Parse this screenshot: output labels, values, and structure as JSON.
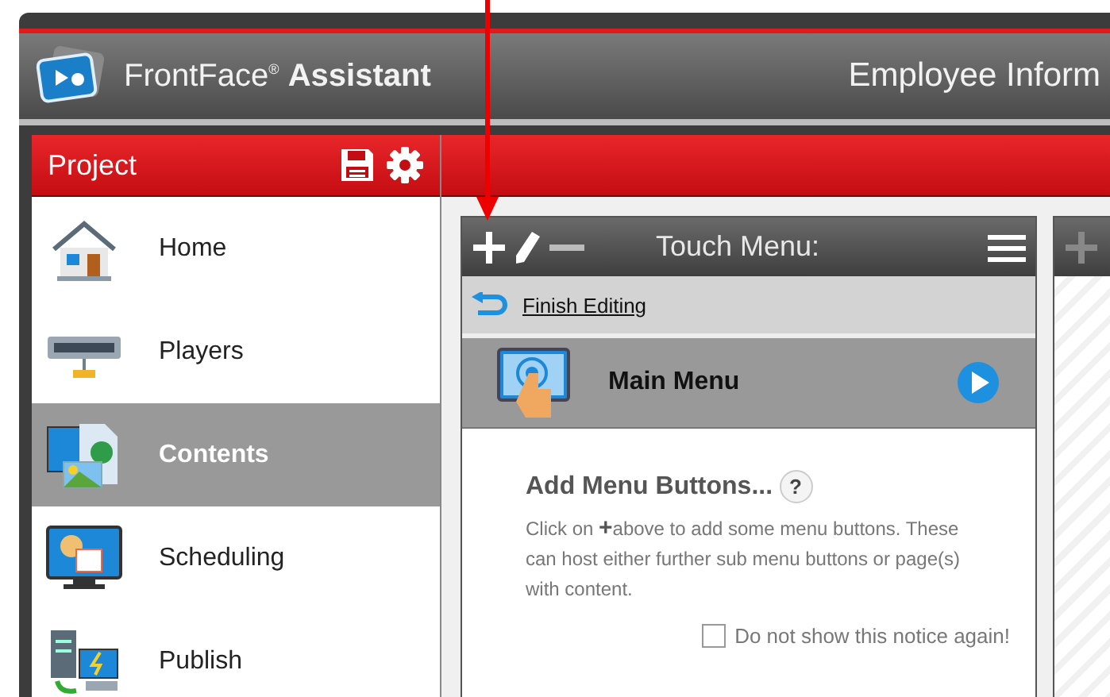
{
  "app": {
    "name": "FrontFace",
    "mark": "®",
    "suffix": "Assistant",
    "document_title": "Employee Inform"
  },
  "sidebar": {
    "title": "Project",
    "items": [
      {
        "label": "Home",
        "selected": false
      },
      {
        "label": "Players",
        "selected": false
      },
      {
        "label": "Contents",
        "selected": true
      },
      {
        "label": "Scheduling",
        "selected": false
      },
      {
        "label": "Publish",
        "selected": false
      }
    ]
  },
  "touch_menu": {
    "title": "Touch Menu:",
    "finish_link": "Finish Editing",
    "main_item": "Main Menu",
    "notice": {
      "title": "Add Menu Buttons...",
      "help": "?",
      "text": "Click on **+**above to add some menu buttons. These can host either further sub menu buttons or page(s) with content.",
      "checkbox_label": "Do not show this notice again!",
      "checked": false
    }
  }
}
